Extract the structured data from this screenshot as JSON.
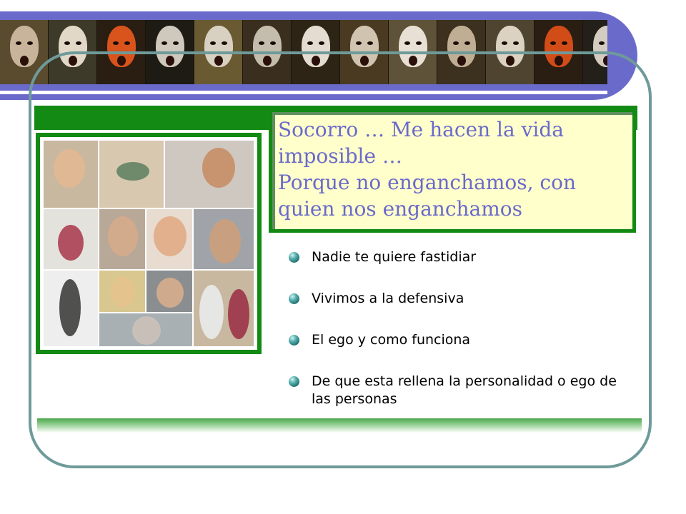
{
  "slide": {
    "title_lines": [
      "Socorro … Me hacen la vida",
      "imposible …",
      "Porque no enganchamos, con",
      "quien nos enganchamos"
    ],
    "bullets": [
      "Nadie te quiere fastidiar",
      "Vivimos a la defensiva",
      "El ego y como funciona",
      "De que esta rellena la personalidad o ego de las personas"
    ]
  },
  "colors": {
    "accent_blue": "#6a6acb",
    "green": "#138a13",
    "title_bg": "#ffffcc",
    "frame": "#6f9a9a"
  },
  "icons": {
    "bullet": "teal-sphere-bullet-icon"
  }
}
